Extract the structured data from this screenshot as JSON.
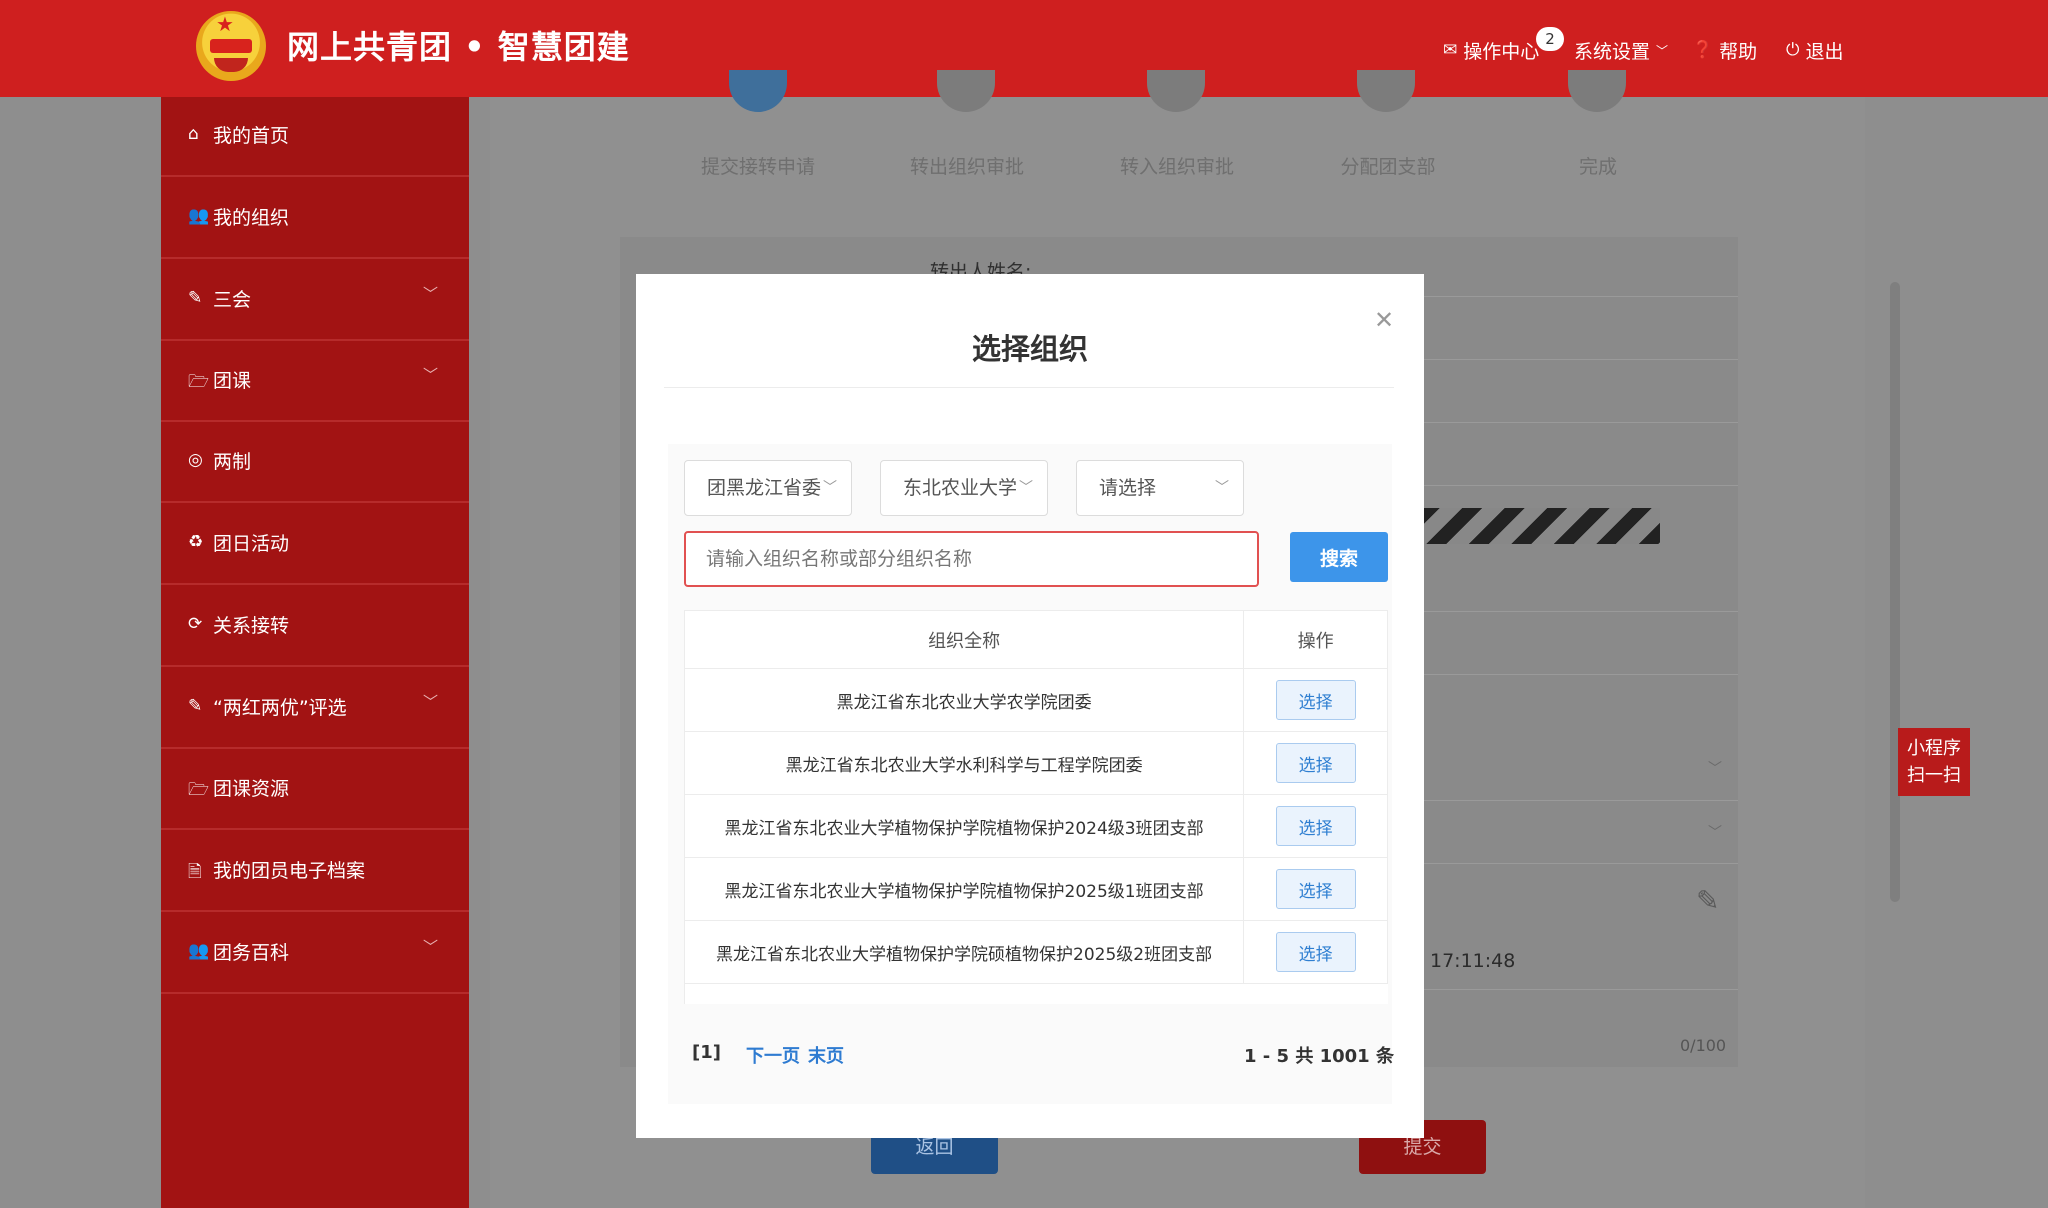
{
  "header": {
    "site_title": "网上共青团 • 智慧团建",
    "nav": {
      "ops_center": "操作中心",
      "ops_badge": "2",
      "settings": "系统设置",
      "help": "帮助",
      "logout": "退出"
    }
  },
  "sidebar": {
    "items": [
      {
        "label": "我的首页",
        "icon": "home-icon"
      },
      {
        "label": "我的组织",
        "icon": "users-icon"
      },
      {
        "label": "三会",
        "icon": "edit-icon"
      },
      {
        "label": "团课",
        "icon": "folder-icon"
      },
      {
        "label": "两制",
        "icon": "target-icon"
      },
      {
        "label": "团日活动",
        "icon": "recycle-icon"
      },
      {
        "label": "关系接转",
        "icon": "refresh-icon"
      },
      {
        "label": "“两红两优”评选",
        "icon": "edit-icon"
      },
      {
        "label": "团课资源",
        "icon": "folder-icon"
      },
      {
        "label": "我的团员电子档案",
        "icon": "file-icon"
      },
      {
        "label": "团务百科",
        "icon": "users-icon"
      }
    ]
  },
  "steps": [
    "提交接转申请",
    "转出组织审批",
    "转入组织审批",
    "分配团支部",
    "完成"
  ],
  "background_form": {
    "name_label": "转出人姓名:",
    "time_value": "17:11:48",
    "char_count": "0/100",
    "back_button": "返回",
    "submit_button": "提交"
  },
  "mini_program": {
    "line1": "小程序",
    "line2": "扫一扫"
  },
  "modal": {
    "title": "选择组织",
    "selects": [
      "团黑龙江省委",
      "东北农业大学",
      "请选择"
    ],
    "search_placeholder": "请输入组织名称或部分组织名称",
    "search_button": "搜索",
    "table": {
      "headers": [
        "组织全称",
        "操作"
      ],
      "rows": [
        {
          "name": "黑龙江省东北农业大学农学院团委",
          "action": "选择"
        },
        {
          "name": "黑龙江省东北农业大学水利科学与工程学院团委",
          "action": "选择"
        },
        {
          "name": "黑龙江省东北农业大学植物保护学院植物保护2024级3班团支部",
          "action": "选择"
        },
        {
          "name": "黑龙江省东北农业大学植物保护学院植物保护2025级1班团支部",
          "action": "选择"
        },
        {
          "name": "黑龙江省东北农业大学植物保护学院硕植物保护2025级2班团支部",
          "action": "选择"
        }
      ]
    },
    "pager": {
      "current": "[1]",
      "next": "下一页",
      "last": "末页",
      "total": "1 - 5  共 1001 条"
    }
  }
}
